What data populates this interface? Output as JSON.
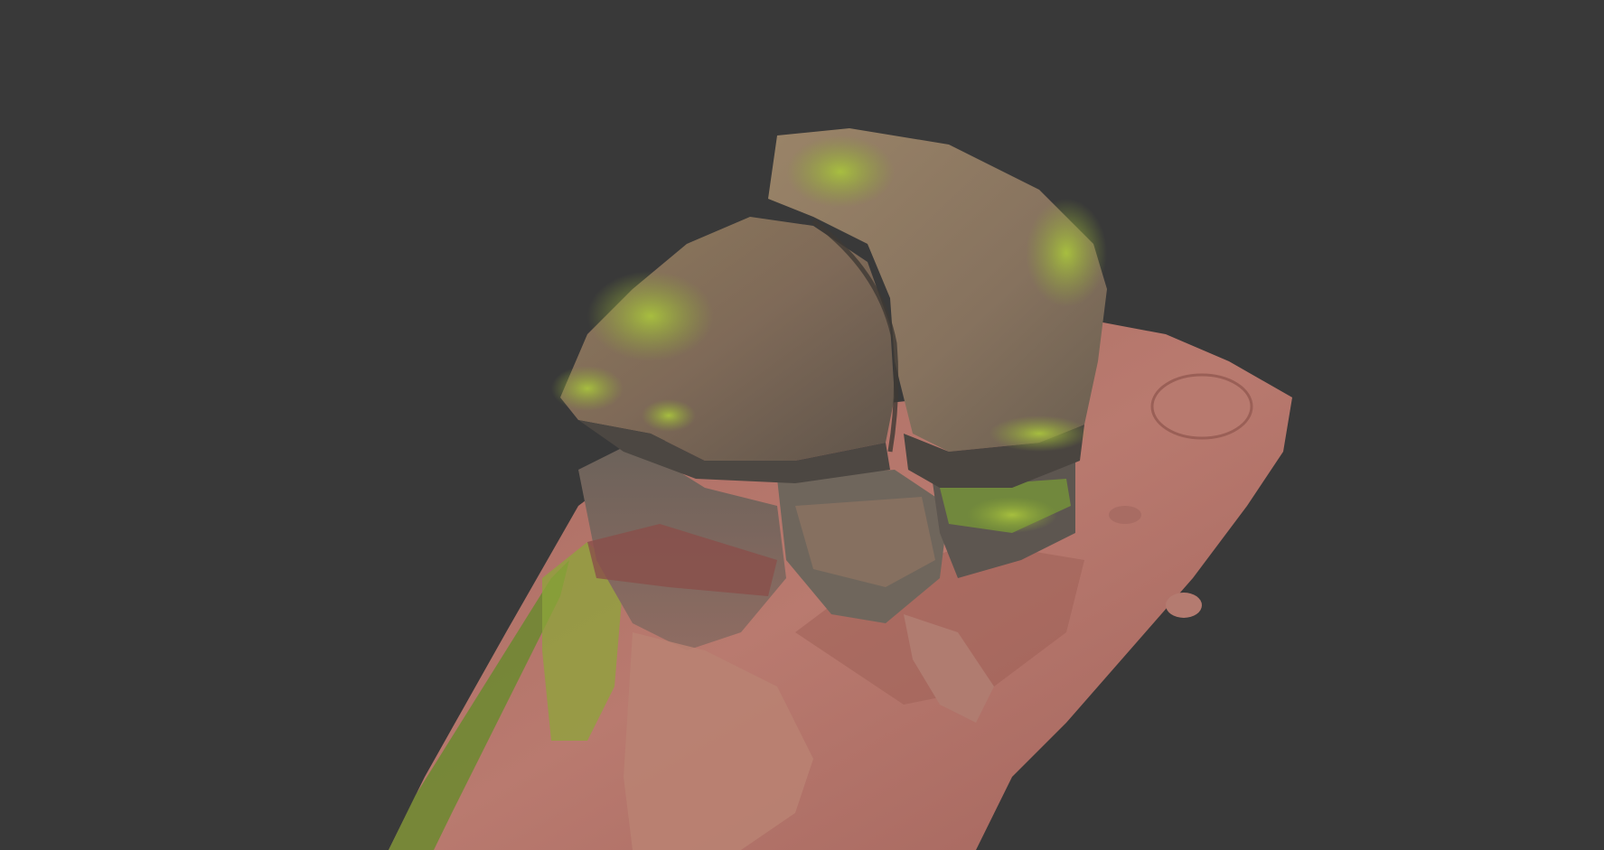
{
  "viewer": {
    "background_color": "#393939",
    "model": {
      "subject": "sandstone-rock-formation-scan",
      "colors": {
        "ground_red": "#b97a6f",
        "ground_dark": "#8f5a52",
        "rock_top": "#8c7766",
        "rock_shadow": "#4a4540",
        "moss": "#9bb33a",
        "moss_dark": "#6f8a2a"
      }
    }
  }
}
